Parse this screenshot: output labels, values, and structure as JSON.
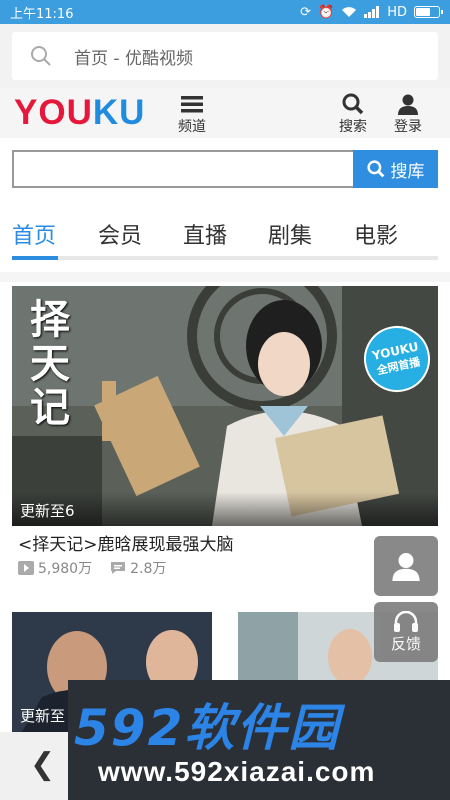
{
  "status_bar": {
    "time": "上午11:16",
    "network": "HD",
    "icons": [
      "alarm-icon",
      "sync-icon",
      "wifi-icon",
      "signal-icon",
      "battery-icon"
    ]
  },
  "browser": {
    "url_text": "首页 - 优酷视频",
    "search_icon": "search-icon"
  },
  "header": {
    "logo": {
      "part1": "YOU",
      "part2": "KU",
      "colors": {
        "red": "#e5173a",
        "blue": "#1f8ce0"
      }
    },
    "channel_label": "频道",
    "search_label": "搜索",
    "login_label": "登录"
  },
  "search": {
    "placeholder": "",
    "button_label": "搜库",
    "accent": "#2f8ee0"
  },
  "tabs": [
    "首页",
    "会员",
    "直播",
    "剧集",
    "电影"
  ],
  "featured": {
    "thumb_title": "择天记",
    "badge_top": "YOUKU",
    "badge_bottom": "全网首播",
    "update": "更新至6",
    "title": "<择天记>鹿晗展现最强大脑",
    "plays": "5,980万",
    "comments": "2.8万"
  },
  "small_cards": [
    {
      "update": "更新至"
    },
    {
      "update": ""
    }
  ],
  "float_buttons": {
    "feedback_label": "反馈"
  },
  "watermark": {
    "brand": "592软件园",
    "url": "www.592xiazai.com"
  }
}
